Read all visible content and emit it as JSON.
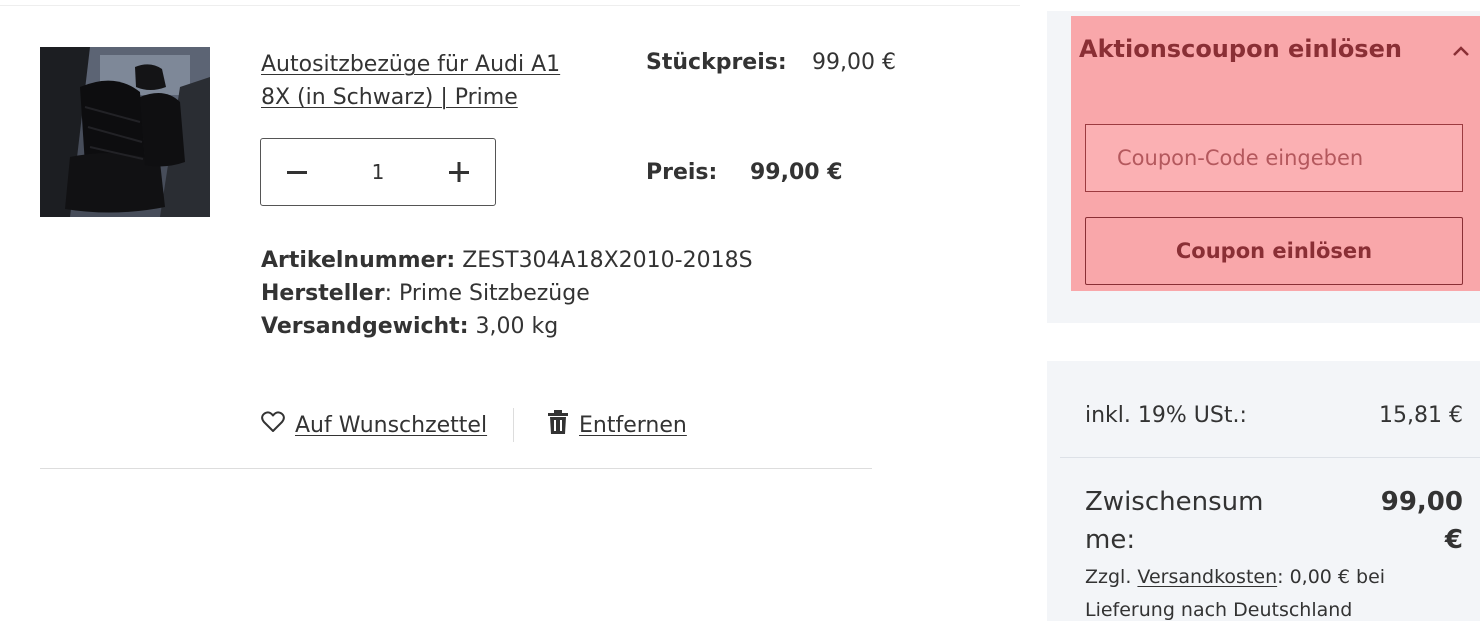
{
  "product": {
    "title": "Autositzbezüge für Audi A1 8X (in Schwarz) | Prime",
    "image_icon": "car-seat-cover-photo",
    "quantity": "1",
    "unit_price_label": "Stückpreis:",
    "unit_price": "99,00 €",
    "price_label": "Preis:",
    "price": "99,00 €",
    "article_number_label": "Artikelnummer:",
    "article_number": "ZEST304A18X2010-2018S",
    "manufacturer_label": "Hersteller",
    "manufacturer": "Prime Sitzbezüge",
    "shipping_weight_label": "Versandgewicht:",
    "shipping_weight": "3,00 kg"
  },
  "actions": {
    "wishlist_label": "Auf Wunschzettel",
    "wishlist_icon": "heart-icon",
    "remove_label": "Entfernen",
    "remove_icon": "trash-icon"
  },
  "stepper": {
    "decrease_icon": "minus-icon",
    "increase_icon": "plus-icon"
  },
  "coupon": {
    "title": "Aktionscoupon einlösen",
    "toggle_icon": "chevron-up-icon",
    "placeholder": "Coupon-Code eingeben",
    "value": "",
    "button_label": "Coupon einlösen"
  },
  "summary": {
    "tax_label": "inkl. 19% USt.:",
    "tax_value": "15,81 €",
    "subtotal_label": "Zwischensumme:",
    "subtotal_value": "99,00 €",
    "shipping_prefix": "Zzgl.",
    "shipping_link": "Versandkosten",
    "shipping_suffix": ": 0,00 € bei Lieferung nach Deutschland"
  },
  "colors": {
    "coupon_highlight": "#f9a7aa",
    "coupon_text": "#8a2f35",
    "panel_background": "#f3f5f8",
    "text": "#333333"
  }
}
